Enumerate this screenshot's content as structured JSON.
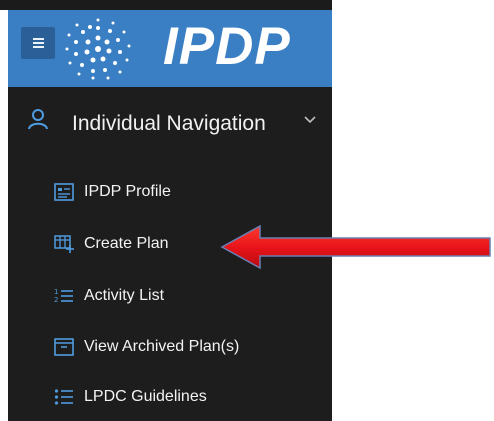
{
  "header": {
    "logo_text": "IPDP",
    "brand_color": "#3a7fc4"
  },
  "sidebar": {
    "group": {
      "title": "Individual Navigation",
      "icon": "user-icon",
      "expanded_icon": "chevron-down-icon"
    },
    "items": [
      {
        "label": "IPDP Profile",
        "icon": "profile-card-icon"
      },
      {
        "label": "Create Plan",
        "icon": "create-plan-icon"
      },
      {
        "label": "Activity List",
        "icon": "numbered-list-icon"
      },
      {
        "label": "View Archived Plan(s)",
        "icon": "archive-box-icon"
      },
      {
        "label": "LPDC Guidelines",
        "icon": "bullet-list-icon"
      }
    ]
  },
  "annotation": {
    "pointer": "red-arrow-icon",
    "target": "Create Plan",
    "color": "#e8141a"
  }
}
